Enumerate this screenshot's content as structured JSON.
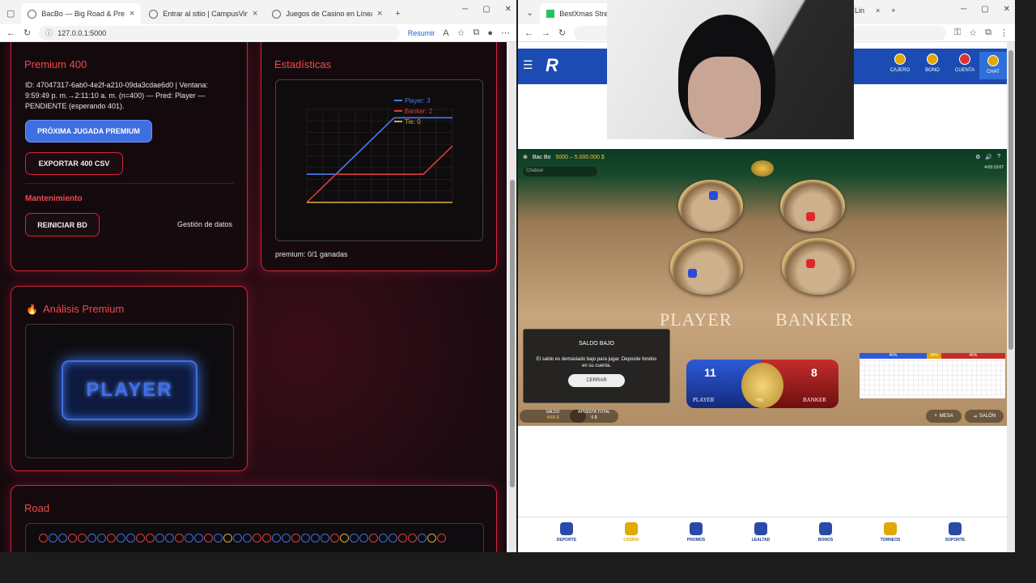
{
  "left_browser": {
    "tabs": [
      {
        "title": "BacBo — Big Road & Premium ·"
      },
      {
        "title": "Entrar al sitio | CampusVirtual -"
      },
      {
        "title": "Juegos de Casino en Línea | Ca:"
      }
    ],
    "url": "127.0.0.1:5000",
    "resumir": "Resumir",
    "premium": {
      "title": "Premium 400",
      "info": "ID: 47047317-6ab0-4e2f-a210-09da3cdae6d0 | Ventana: 9:59:49 p. m.→2:11:10 a. m. (n=400) — Pred: Player — PENDIENTE (esperando 401).",
      "next_btn": "PRÓXIMA JUGADA PREMIUM",
      "export_btn": "EXPORTAR 400 CSV",
      "maint_title": "Mantenimiento",
      "reset_btn": "REINICIAR BD",
      "data_mgmt": "Gestión de datos"
    },
    "stats": {
      "title": "Estadísticas",
      "footer": "premium: 0/1 ganadas"
    },
    "analysis": {
      "title": "Análisis Premium",
      "prediction": "PLAYER"
    },
    "road": {
      "title": "Road"
    },
    "colors": {
      "accent": "#d2233a",
      "player": "#3e6fe0",
      "banker": "#e23a3a",
      "tie": "#e0b030"
    }
  },
  "chart_data": {
    "type": "line",
    "title": "",
    "xlabel": "",
    "ylabel": "",
    "x": [
      0,
      1,
      2,
      3,
      4,
      5
    ],
    "series": [
      {
        "name": "Player: 3",
        "color": "#4a7bf0",
        "values": [
          1,
          1,
          2,
          3,
          3,
          3
        ]
      },
      {
        "name": "Banker: 2",
        "color": "#e23a3a",
        "values": [
          0,
          1,
          1,
          1,
          1,
          2
        ]
      },
      {
        "name": "Tie: 0",
        "color": "#e0b030",
        "values": [
          0,
          0,
          0,
          0,
          0,
          0
        ]
      }
    ],
    "ylim": [
      0,
      3.3
    ],
    "grid": true,
    "legend": "top-right"
  },
  "right_browser": {
    "tab_title": "BestXmas Stream",
    "tab_title_2": "Lin",
    "nav": {
      "cajero": "CAJERO",
      "bono": "BONO",
      "cuenta": "CUENTA",
      "chat": "CHAT"
    },
    "game": {
      "table_name": "Bac Bo",
      "limits": "5000 – 5.000.000 $",
      "chat_placeholder": "Chatear",
      "player_word": "PLAYER",
      "banker_word": "BANKER",
      "player_score": "11",
      "banker_score": "8",
      "player_label": "PLAYER",
      "banker_label": "BANKER",
      "tie_label": "TIE",
      "low_balance_title": "SALDO BAJO",
      "low_balance_msg": "El saldo es demasiado bajo para jugar. Deposite fondos en su cuenta.",
      "close_btn": "CERRAR",
      "saldo_label": "SALDO",
      "saldo_value": "4500 $",
      "apuesta_label": "APUESTA TOTAL",
      "apuesta_value": "0 $",
      "mesa_btn": "MESA",
      "salon_btn": "SALÓN",
      "pct_player": "46%",
      "pct_tie": "10%",
      "pct_banker": "46%",
      "timer": "4:03:13:07"
    },
    "bottom": [
      "DEPORTE",
      "CASINO",
      "PROMOS",
      "LEALTAD",
      "BONOS",
      "TORNEOS",
      "SOPORTE"
    ]
  }
}
